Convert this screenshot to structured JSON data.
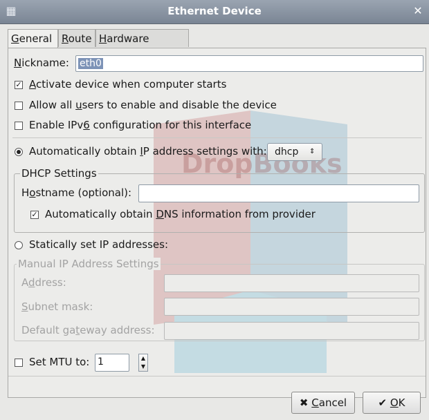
{
  "window": {
    "title": "Ethernet Device"
  },
  "tabs": [
    {
      "label": "General",
      "accel": "G",
      "rest": "eneral"
    },
    {
      "label": "Route",
      "accel": "R",
      "rest": "oute"
    },
    {
      "label": "Hardware Device",
      "accel": "H",
      "rest": "ardware Device"
    }
  ],
  "nickname": {
    "label_accel": "N",
    "label_rest": "ickname:",
    "value": "eth0"
  },
  "options": {
    "activate": {
      "checked": true,
      "pre": "",
      "accel": "A",
      "post": "ctivate device when computer starts"
    },
    "allow_users": {
      "checked": false,
      "pre": "Allow all ",
      "accel": "u",
      "post": "sers to enable and disable the device"
    },
    "ipv6": {
      "checked": false,
      "pre": "Enable IPv",
      "accel": "6",
      "post": " configuration for this interface"
    }
  },
  "auto_ip": {
    "selected": true,
    "pre": "Automatically obtain ",
    "accel": "I",
    "post": "P address settings with:",
    "protocol": "dhcp"
  },
  "dhcp": {
    "title": "DHCP Settings",
    "hostname_pre": "H",
    "hostname_accel": "o",
    "hostname_post": "stname (optional):",
    "hostname_value": "",
    "dns": {
      "checked": true,
      "pre": "Automatically obtain ",
      "accel": "D",
      "post": "NS information from provider"
    }
  },
  "static_ip": {
    "selected": false,
    "label": "Statically set IP addresses:"
  },
  "manual": {
    "title": "Manual IP Address Settings",
    "address_pre": "A",
    "address_accel": "d",
    "address_post": "dress:",
    "subnet_pre": "",
    "subnet_accel": "S",
    "subnet_post": "ubnet mask:",
    "gateway_pre": "Default ga",
    "gateway_accel": "t",
    "gateway_post": "eway address:"
  },
  "mtu": {
    "checked": false,
    "label": "Set MTU to:",
    "value": "1"
  },
  "buttons": {
    "cancel_accel": "C",
    "cancel_rest": "ancel",
    "ok_accel": "O",
    "ok_rest": "K"
  },
  "watermark": {
    "text": "DropBooks"
  }
}
